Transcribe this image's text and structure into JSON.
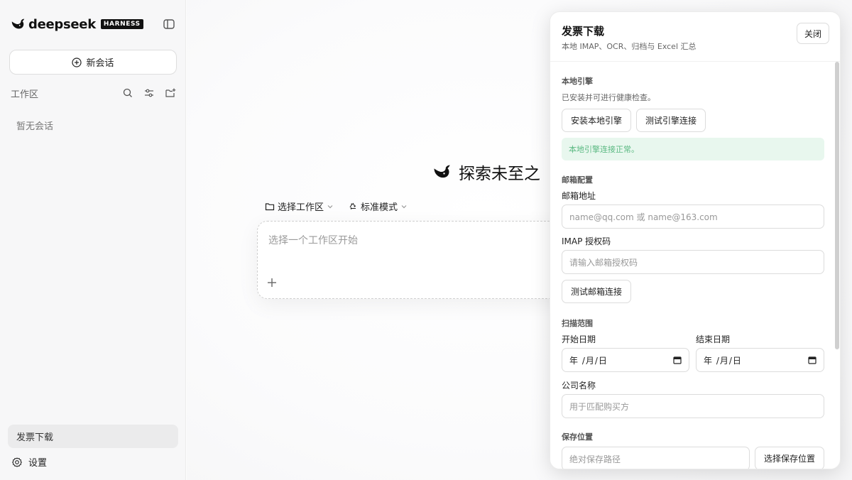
{
  "app": {
    "brand_name": "deepseek",
    "brand_badge": "HARNESS"
  },
  "sidebar": {
    "new_chat_label": "新会话",
    "workspace_label": "工作区",
    "empty_note": "暂无会话",
    "active_item": "发票下载",
    "settings_label": "设置"
  },
  "main": {
    "hero_text": "探索未至之",
    "workspace_chip": "选择工作区",
    "mode_chip": "标准模式",
    "composer_placeholder": "选择一个工作区开始"
  },
  "drawer": {
    "title": "发票下载",
    "subtitle": "本地 IMAP、OCR、归档与 Excel 汇总",
    "close_label": "关闭",
    "engine": {
      "section_title": "本地引擎",
      "hint": "已安装并可进行健康检查。",
      "install_button": "安装本地引擎",
      "test_button": "测试引擎连接",
      "status_message": "本地引擎连接正常。"
    },
    "mail": {
      "section_title": "邮箱配置",
      "address_label": "邮箱地址",
      "address_placeholder": "name@qq.com 或 name@163.com",
      "auth_label": "IMAP 授权码",
      "auth_placeholder": "请输入邮箱授权码",
      "test_button": "测试邮箱连接"
    },
    "scan": {
      "section_title": "扫描范围",
      "start_label": "开始日期",
      "end_label": "结束日期",
      "date_placeholder": "年 /月/日",
      "company_label": "公司名称",
      "company_placeholder": "用于匹配购买方"
    },
    "save": {
      "section_title": "保存位置",
      "path_placeholder": "绝对保存路径",
      "choose_button": "选择保存位置"
    }
  }
}
